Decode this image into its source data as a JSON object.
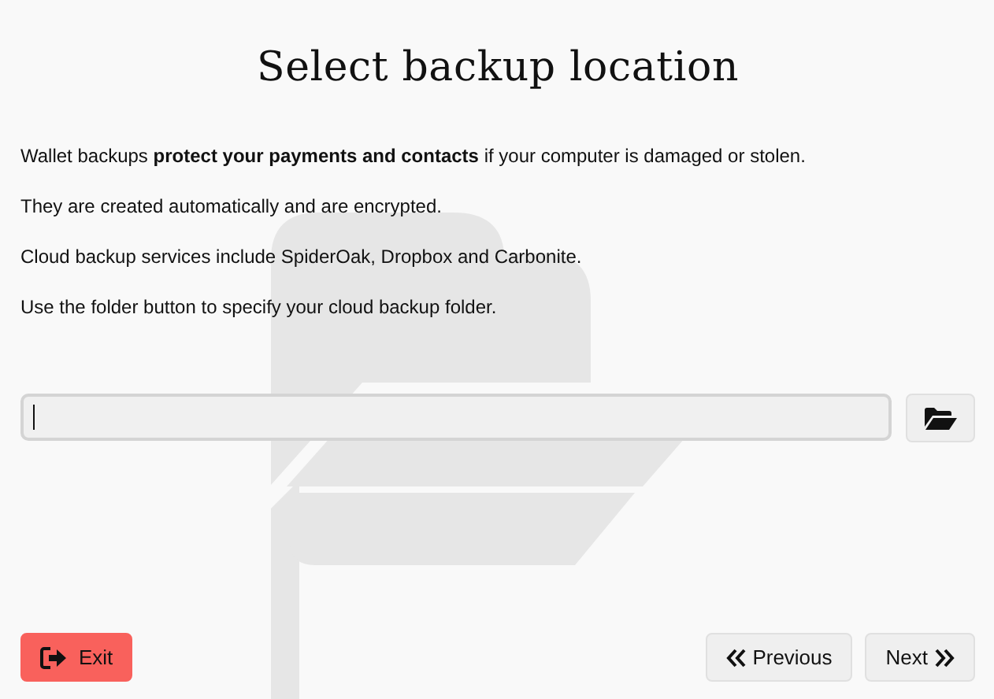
{
  "title": "Select backup location",
  "paragraphs": [
    "Wallet backups **protect your payments and contacts** if your computer is damaged or stolen.",
    "They are created automatically and are encrypted.",
    "Cloud backup services include SpiderOak, Dropbox and Carbonite.",
    "Use the folder button to specify your cloud backup folder."
  ],
  "buttons": [
    {
      "label": "Exit",
      "kind": "exit"
    },
    {
      "label": "Previous",
      "kind": "previous"
    },
    {
      "label": "Next",
      "kind": "next"
    }
  ]
}
